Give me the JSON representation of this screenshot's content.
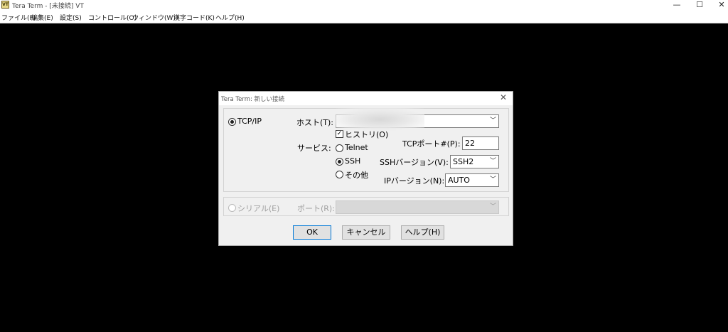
{
  "window": {
    "title": "Tera Term - [未接続] VT",
    "icon": "VT",
    "controls": {
      "minimize": "—",
      "maximize": "☐",
      "close": "✕"
    }
  },
  "menu": [
    "ファイル(F)",
    "編集(E)",
    "設定(S)",
    "コントロール(O)",
    "ウィンドウ(W)",
    "漢字コード(K)",
    "ヘルプ(H)"
  ],
  "dialog": {
    "title": "Tera Term: 新しい接続",
    "close": "✕",
    "tcpip": {
      "radio_label": "TCP/IP",
      "selected": true,
      "host_label": "ホスト(T):",
      "host_value": "",
      "history_label": "ヒストリ(O)",
      "history_checked": true,
      "service_label": "サービス:",
      "services": [
        {
          "label": "Telnet",
          "selected": false
        },
        {
          "label": "SSH",
          "selected": true
        },
        {
          "label": "その他",
          "selected": false
        }
      ],
      "tcp_port_label": "TCPポート#(P):",
      "tcp_port_value": "22",
      "ssh_version_label": "SSHバージョン(V):",
      "ssh_version_value": "SSH2",
      "ip_version_label": "IPバージョン(N):",
      "ip_version_value": "AUTO"
    },
    "serial": {
      "radio_label": "シリアル(E)",
      "port_label": "ポート(R):",
      "port_value": ""
    },
    "buttons": {
      "ok": "OK",
      "cancel": "キャンセル",
      "help": "ヘルプ(H)"
    }
  }
}
